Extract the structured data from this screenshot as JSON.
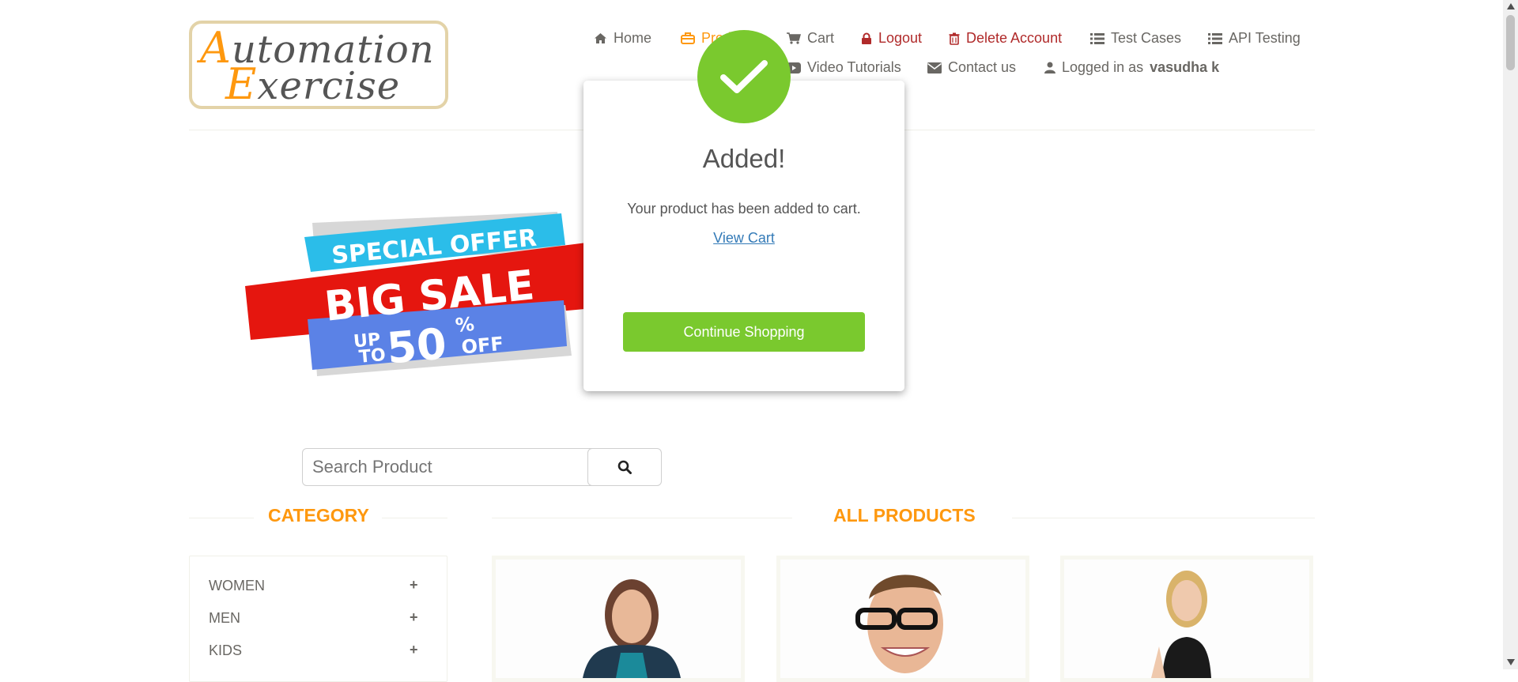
{
  "logo": {
    "line1_cap": "A",
    "line1_rest": "utomation",
    "line2_cap": "E",
    "line2_rest": "xercise"
  },
  "nav": {
    "home": "Home",
    "products": "Products",
    "cart": "Cart",
    "logout": "Logout",
    "delete_account": "Delete Account",
    "test_cases": "Test Cases",
    "api_testing": "API Testing",
    "video_tutorials": "Video Tutorials",
    "contact_us": "Contact us",
    "logged_in_prefix": "Logged in as",
    "username": "vasudha k"
  },
  "banner": {
    "line1": "SPECIAL OFFER",
    "line2": "BIG SALE",
    "line3_up": "UP",
    "line3_to": "TO",
    "line3_num": "50",
    "line3_pct": "%",
    "line3_off": "OFF"
  },
  "search": {
    "placeholder": "Search Product"
  },
  "sections": {
    "category": "CATEGORY",
    "all_products": "ALL PRODUCTS"
  },
  "categories": [
    {
      "label": "WOMEN"
    },
    {
      "label": "MEN"
    },
    {
      "label": "KIDS"
    }
  ],
  "modal": {
    "title": "Added!",
    "message": "Your product has been added to cart.",
    "link": "View Cart",
    "button": "Continue Shopping"
  },
  "colors": {
    "accent_orange": "#fe980f",
    "success_green": "#7ac92e",
    "link_blue": "#337ab7",
    "danger_red": "#b02a2a"
  }
}
